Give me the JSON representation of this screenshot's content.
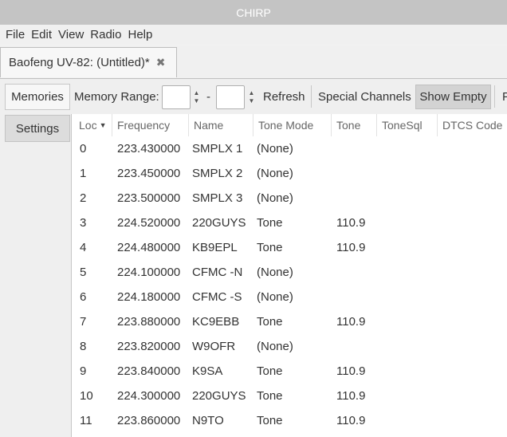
{
  "window": {
    "title": "CHIRP"
  },
  "menu": [
    "File",
    "Edit",
    "View",
    "Radio",
    "Help"
  ],
  "file_tab": {
    "label": "Baofeng UV-82: (Untitled)*",
    "close_glyph": "✖"
  },
  "toolbar": {
    "memories_tab": "Memories",
    "memory_range_label": "Memory Range:",
    "range_start": "",
    "range_end": "",
    "dash": "-",
    "refresh": "Refresh",
    "special_channels": "Special Channels",
    "show_empty": "Show Empty",
    "overflow": "P"
  },
  "sidebar": {
    "settings_tab": "Settings"
  },
  "columns": [
    "Loc",
    "Frequency",
    "Name",
    "Tone Mode",
    "Tone",
    "ToneSql",
    "DTCS Code"
  ],
  "rows": [
    {
      "loc": "0",
      "freq": "223.430000",
      "name": "SMPLX 1",
      "mode": "(None)",
      "tone": ""
    },
    {
      "loc": "1",
      "freq": "223.450000",
      "name": "SMPLX 2",
      "mode": "(None)",
      "tone": ""
    },
    {
      "loc": "2",
      "freq": "223.500000",
      "name": "SMPLX 3",
      "mode": "(None)",
      "tone": ""
    },
    {
      "loc": "3",
      "freq": "224.520000",
      "name": "220GUYS",
      "mode": "Tone",
      "tone": "110.9"
    },
    {
      "loc": "4",
      "freq": "224.480000",
      "name": "KB9EPL",
      "mode": "Tone",
      "tone": "110.9"
    },
    {
      "loc": "5",
      "freq": "224.100000",
      "name": "CFMC -N",
      "mode": "(None)",
      "tone": ""
    },
    {
      "loc": "6",
      "freq": "224.180000",
      "name": "CFMC -S",
      "mode": "(None)",
      "tone": ""
    },
    {
      "loc": "7",
      "freq": "223.880000",
      "name": "KC9EBB",
      "mode": "Tone",
      "tone": "110.9"
    },
    {
      "loc": "8",
      "freq": "223.820000",
      "name": "W9OFR",
      "mode": "(None)",
      "tone": ""
    },
    {
      "loc": "9",
      "freq": "223.840000",
      "name": "K9SA",
      "mode": "Tone",
      "tone": "110.9"
    },
    {
      "loc": "10",
      "freq": "224.300000",
      "name": "220GUYS",
      "mode": "Tone",
      "tone": "110.9"
    },
    {
      "loc": "11",
      "freq": "223.860000",
      "name": "N9TO",
      "mode": "Tone",
      "tone": "110.9"
    }
  ]
}
